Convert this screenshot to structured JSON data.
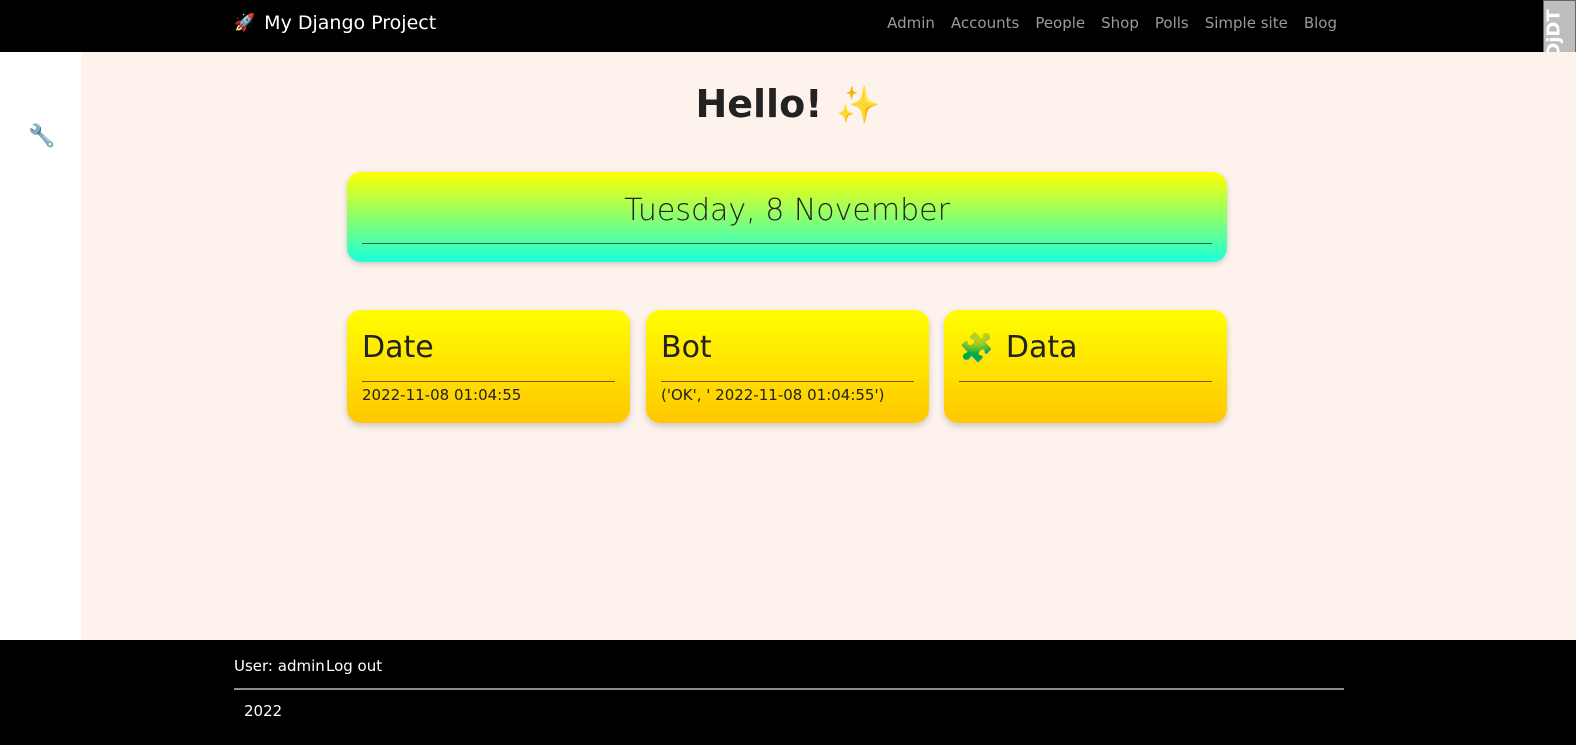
{
  "navbar": {
    "brand_icon": "🚀",
    "brand": "My Django Project",
    "links": [
      "Admin",
      "Accounts",
      "People",
      "Shop",
      "Polls",
      "Simple site",
      "Blog"
    ]
  },
  "debug_toolbar": {
    "label": "DjDT"
  },
  "sidebar": {
    "icon": "🔧"
  },
  "main": {
    "title": "Hello!",
    "title_icon": "✨",
    "banner": {
      "date": "Tuesday, 8 November"
    },
    "cards": [
      {
        "title": "Date",
        "icon": "",
        "text": "2022-11-08 01:04:55"
      },
      {
        "title": "Bot",
        "icon": "",
        "text": "('OK', ' 2022-11-08 01:04:55')"
      },
      {
        "title": "Data",
        "icon": "🧩",
        "text": ""
      }
    ]
  },
  "footer": {
    "user": "User: admin",
    "logout": "Log out",
    "year": "2022"
  },
  "colors": {
    "nav_bg": "#000000",
    "main_bg": "#fdf2ec",
    "card_top": "#ffff00",
    "card_bottom": "#ffc700",
    "banner_bottom": "#1affdb"
  }
}
